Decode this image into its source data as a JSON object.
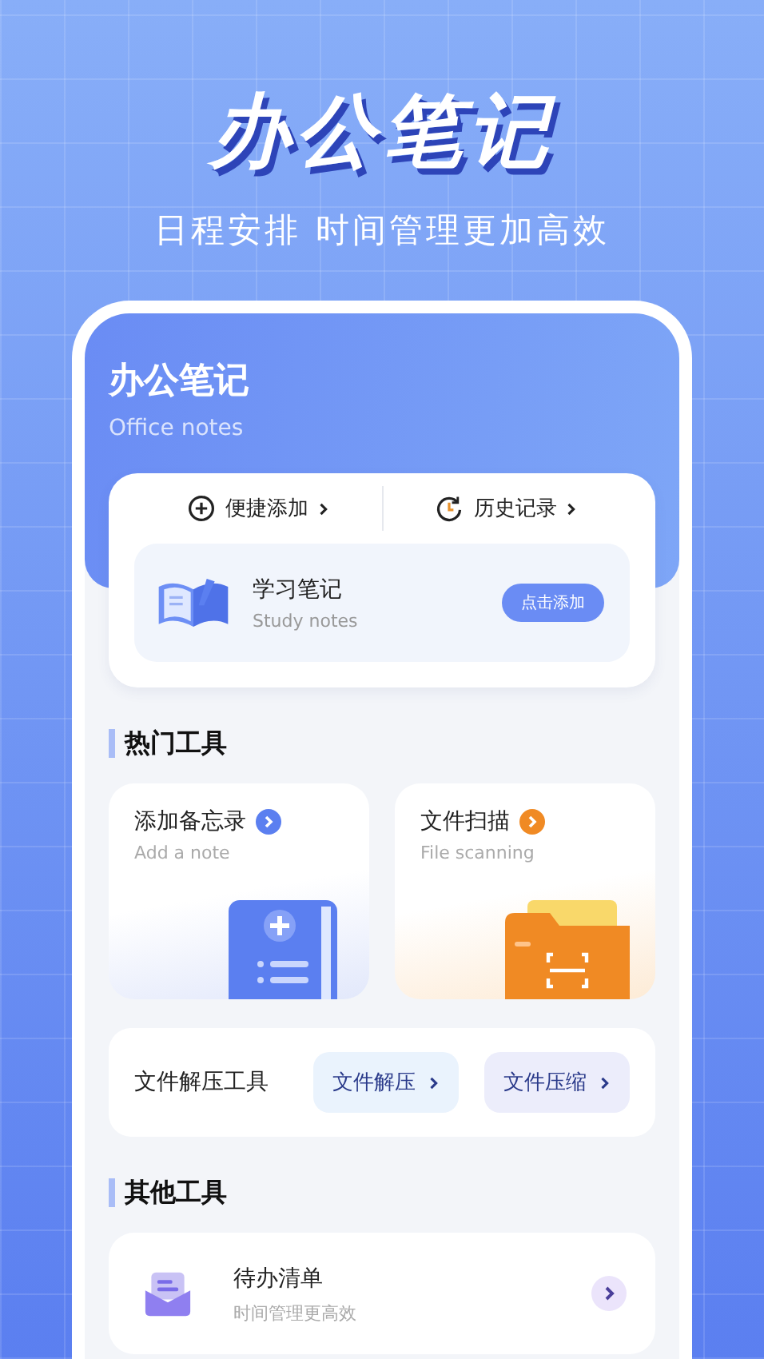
{
  "banner": {
    "title": "办公笔记",
    "subtitle": "日程安排 时间管理更加高效"
  },
  "app": {
    "title": "办公笔记",
    "subtitle": "Office notes"
  },
  "quick_actions": [
    {
      "label": "便捷添加",
      "kind": "add"
    },
    {
      "label": "历史记录",
      "kind": "history"
    }
  ],
  "feature": {
    "title": "学习笔记",
    "subtitle": "Study notes",
    "button": "点击添加"
  },
  "hot_tools": {
    "heading": "热门工具",
    "cards": [
      {
        "title": "添加备忘录",
        "subtitle": "Add a note",
        "kind": "note"
      },
      {
        "title": "文件扫描",
        "subtitle": "File scanning",
        "kind": "scan"
      }
    ],
    "compress": {
      "label": "文件解压工具",
      "buttons": [
        {
          "label": "文件解压",
          "kind": "extract"
        },
        {
          "label": "文件压缩",
          "kind": "compress"
        }
      ]
    }
  },
  "other_tools": {
    "heading": "其他工具",
    "items": [
      {
        "title": "待办清单",
        "subtitle": "时间管理更高效"
      }
    ]
  }
}
